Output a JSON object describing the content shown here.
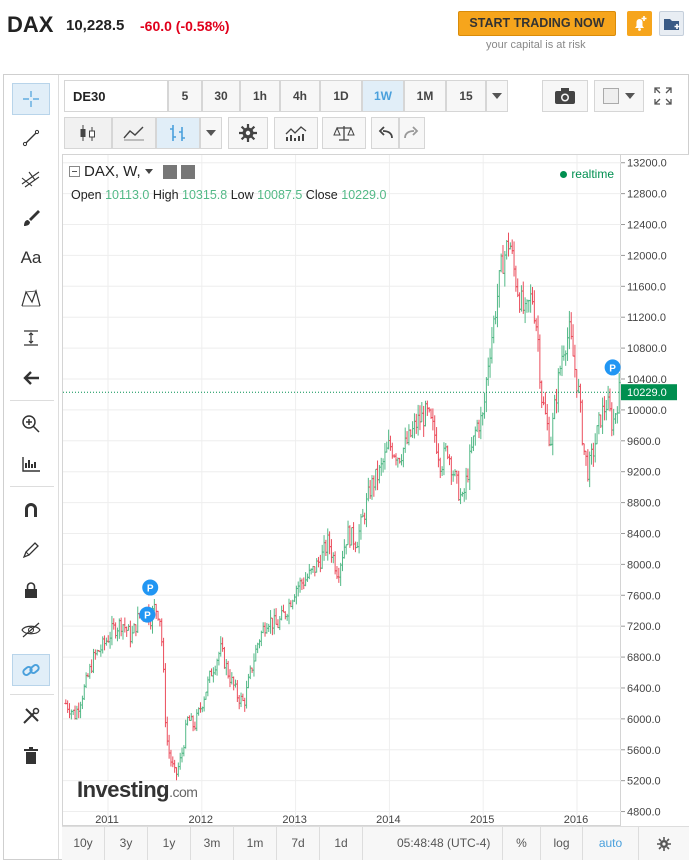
{
  "header": {
    "symbol": "DAX",
    "last": "10,228.5",
    "change": "-60.0 (-0.58%)",
    "trade_label": "START TRADING NOW",
    "risk_note": "your capital is at risk"
  },
  "toolbar": {
    "symbol_input": "DE30",
    "intervals": [
      "5",
      "30",
      "1h",
      "4h",
      "1D",
      "1W",
      "1M",
      "15"
    ],
    "selected_interval": "1W"
  },
  "legend": {
    "title": "DAX, W,",
    "open_label": "Open",
    "open": "10113.0",
    "high_label": "High",
    "high": "10315.8",
    "low_label": "Low",
    "low": "10087.5",
    "close_label": "Close",
    "close": "10229.0",
    "status": "realtime"
  },
  "watermark": {
    "brand": "Investing",
    "suffix": ".com"
  },
  "bottombar": {
    "ranges": [
      "10y",
      "3y",
      "1y",
      "3m",
      "1m",
      "7d",
      "1d"
    ],
    "time": "05:48:48 (UTC-4)",
    "percent": "%",
    "log": "log",
    "auto": "auto"
  },
  "colors": {
    "up": "#53b987",
    "down": "#eb4d5c",
    "accent": "#4aa0dc",
    "price_line": "#008f50"
  },
  "icons": [
    "crosshair-icon",
    "trendline-icon",
    "pitchfork-icon",
    "brush-icon",
    "text-icon",
    "pattern-icon",
    "measure-icon",
    "back-arrow-icon",
    "zoom-icon",
    "ruler-icon",
    "magnet-icon",
    "lock-pencil-icon",
    "lock-icon",
    "eye-off-icon",
    "link-icon",
    "tools-icon",
    "trash-icon",
    "camera-icon",
    "fullscreen-icon"
  ],
  "chart_data": {
    "type": "candlestick",
    "title": "DAX, W,",
    "ylim": [
      4600,
      13300
    ],
    "yticks": [
      13200,
      12800,
      12400,
      12000,
      11600,
      11200,
      10800,
      10400,
      10000,
      9600,
      9200,
      8800,
      8400,
      8000,
      7600,
      7200,
      6800,
      6400,
      6000,
      5600,
      5200,
      4800
    ],
    "ytick_labels": [
      "13200.0",
      "12800.0",
      "12400.0",
      "12000.0",
      "11600.0",
      "11200.0",
      "10800.0",
      "10400.0",
      "10000.0",
      "9600.0",
      "9200.0",
      "8800.0",
      "8400.0",
      "8000.0",
      "7600.0",
      "7200.0",
      "6800.0",
      "6400.0",
      "6000.0",
      "5600.0",
      "5200.0",
      "4800.0"
    ],
    "xticks": [
      "2011",
      "2012",
      "2013",
      "2014",
      "2015",
      "2016"
    ],
    "xlim": [
      2010.52,
      2016.48
    ],
    "current_price": 10229.0,
    "current_price_label": "10229.0",
    "closes": [
      [
        2010.55,
        6200
      ],
      [
        2010.65,
        6050
      ],
      [
        2010.75,
        6400
      ],
      [
        2010.85,
        6800
      ],
      [
        2010.95,
        6950
      ],
      [
        2011.05,
        7150
      ],
      [
        2011.15,
        7250
      ],
      [
        2011.25,
        7050
      ],
      [
        2011.32,
        7300
      ],
      [
        2011.4,
        7450
      ],
      [
        2011.45,
        7300
      ],
      [
        2011.5,
        7450
      ],
      [
        2011.55,
        7350
      ],
      [
        2011.58,
        6900
      ],
      [
        2011.62,
        5800
      ],
      [
        2011.66,
        5500
      ],
      [
        2011.72,
        5250
      ],
      [
        2011.78,
        5500
      ],
      [
        2011.85,
        6000
      ],
      [
        2011.92,
        5900
      ],
      [
        2012.0,
        6200
      ],
      [
        2012.1,
        6600
      ],
      [
        2012.2,
        6900
      ],
      [
        2012.28,
        6600
      ],
      [
        2012.38,
        6300
      ],
      [
        2012.45,
        6200
      ],
      [
        2012.52,
        6600
      ],
      [
        2012.6,
        7000
      ],
      [
        2012.7,
        7300
      ],
      [
        2012.8,
        7200
      ],
      [
        2012.9,
        7400
      ],
      [
        2013.0,
        7700
      ],
      [
        2013.1,
        7800
      ],
      [
        2013.18,
        7900
      ],
      [
        2013.28,
        8100
      ],
      [
        2013.35,
        8300
      ],
      [
        2013.45,
        7900
      ],
      [
        2013.55,
        8400
      ],
      [
        2013.65,
        8300
      ],
      [
        2013.72,
        8600
      ],
      [
        2013.8,
        9000
      ],
      [
        2013.9,
        9200
      ],
      [
        2014.0,
        9550
      ],
      [
        2014.1,
        9400
      ],
      [
        2014.2,
        9600
      ],
      [
        2014.3,
        9850
      ],
      [
        2014.4,
        9950
      ],
      [
        2014.48,
        9700
      ],
      [
        2014.55,
        9300
      ],
      [
        2014.62,
        9500
      ],
      [
        2014.7,
        9100
      ],
      [
        2014.78,
        8800
      ],
      [
        2014.85,
        9300
      ],
      [
        2014.93,
        9800
      ],
      [
        2015.0,
        9900
      ],
      [
        2015.05,
        10600
      ],
      [
        2015.12,
        11200
      ],
      [
        2015.2,
        11900
      ],
      [
        2015.28,
        12200
      ],
      [
        2015.33,
        11800
      ],
      [
        2015.38,
        11500
      ],
      [
        2015.45,
        11200
      ],
      [
        2015.52,
        11500
      ],
      [
        2015.58,
        11000
      ],
      [
        2015.62,
        10200
      ],
      [
        2015.68,
        9800
      ],
      [
        2015.72,
        9600
      ],
      [
        2015.78,
        10200
      ],
      [
        2015.85,
        10800
      ],
      [
        2015.92,
        11000
      ],
      [
        2015.97,
        10600
      ],
      [
        2016.02,
        10200
      ],
      [
        2016.07,
        9500
      ],
      [
        2016.12,
        9200
      ],
      [
        2016.18,
        9500
      ],
      [
        2016.25,
        9900
      ],
      [
        2016.32,
        10100
      ],
      [
        2016.38,
        9800
      ],
      [
        2016.45,
        10229
      ]
    ],
    "markers": [
      {
        "label": "P",
        "x": 2011.45,
        "y": 7700
      },
      {
        "label": "P",
        "x": 2011.42,
        "y": 7350
      },
      {
        "label": "P",
        "x": 2016.38,
        "y": 10550
      }
    ]
  }
}
